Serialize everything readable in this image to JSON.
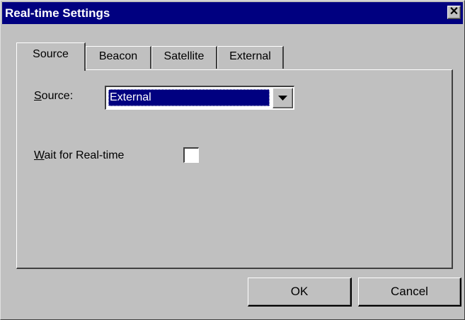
{
  "window": {
    "title": "Real-time Settings",
    "close_glyph": "✕"
  },
  "tabs": [
    {
      "label": "Source",
      "active": true
    },
    {
      "label": "Beacon",
      "active": false
    },
    {
      "label": "Satellite",
      "active": false
    },
    {
      "label": "External",
      "active": false
    }
  ],
  "source": {
    "label_mnemonic": "S",
    "label_rest": "ource:",
    "selected_value": "External"
  },
  "wait": {
    "label_mnemonic": "W",
    "label_rest": "ait for Real-time",
    "checked": false
  },
  "buttons": {
    "ok": "OK",
    "cancel": "Cancel"
  },
  "colors": {
    "titlebar": "#000080",
    "face": "#c0c0c0",
    "selection": "#000080"
  }
}
